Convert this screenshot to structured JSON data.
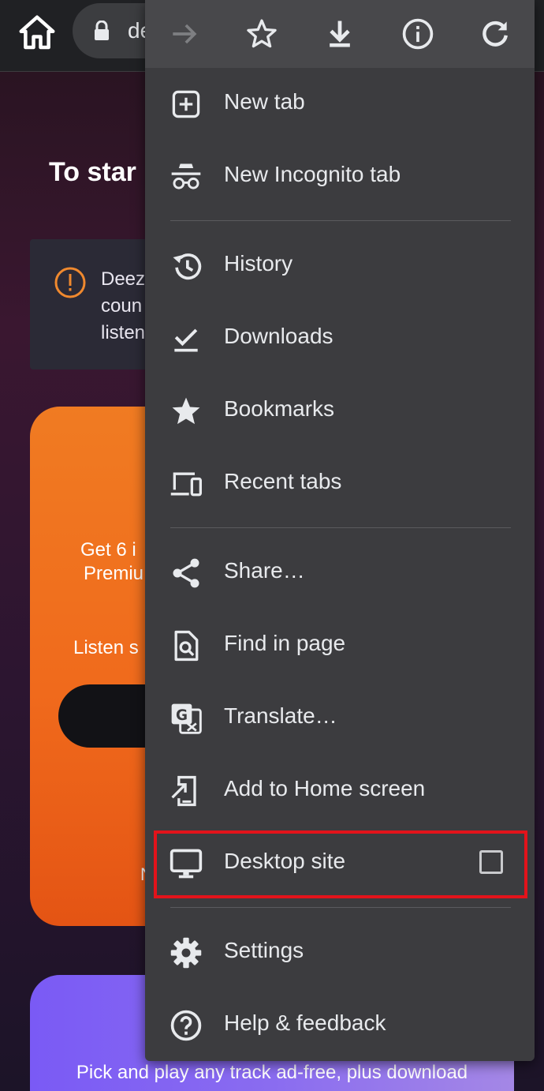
{
  "url_bar": {
    "text": "de"
  },
  "page": {
    "heading": "To star",
    "alert_lines": "Deez\ncoun\nlisten",
    "promo": {
      "line1": "Get 6 i",
      "line2": "Premiu",
      "line3": "Listen s",
      "small": "N"
    },
    "bottom_card_text": "Pick and play any track ad-free, plus download"
  },
  "toolbar": {
    "buttons": [
      "forward-icon",
      "bookmark-star-icon",
      "download-icon",
      "info-icon",
      "refresh-icon"
    ]
  },
  "menu": {
    "items": [
      {
        "label": "New tab",
        "icon": "new-tab-icon"
      },
      {
        "label": "New Incognito tab",
        "icon": "incognito-icon"
      },
      {
        "label": "History",
        "icon": "history-icon"
      },
      {
        "label": "Downloads",
        "icon": "downloads-icon"
      },
      {
        "label": "Bookmarks",
        "icon": "bookmarks-icon"
      },
      {
        "label": "Recent tabs",
        "icon": "recent-tabs-icon"
      },
      {
        "label": "Share…",
        "icon": "share-icon"
      },
      {
        "label": "Find in page",
        "icon": "find-in-page-icon"
      },
      {
        "label": "Translate…",
        "icon": "translate-icon"
      },
      {
        "label": "Add to Home screen",
        "icon": "add-to-home-icon"
      },
      {
        "label": "Desktop site",
        "icon": "desktop-icon",
        "checked": false
      },
      {
        "label": "Settings",
        "icon": "settings-icon"
      },
      {
        "label": "Help & feedback",
        "icon": "help-icon"
      }
    ]
  },
  "colors": {
    "menu_bg": "#3c3c3f",
    "toolbar_bg": "#48484b",
    "text": "#e8eaed",
    "highlight": "#e3131b",
    "promo_orange": "#f07b22",
    "purple_card": "#7a5af5"
  }
}
